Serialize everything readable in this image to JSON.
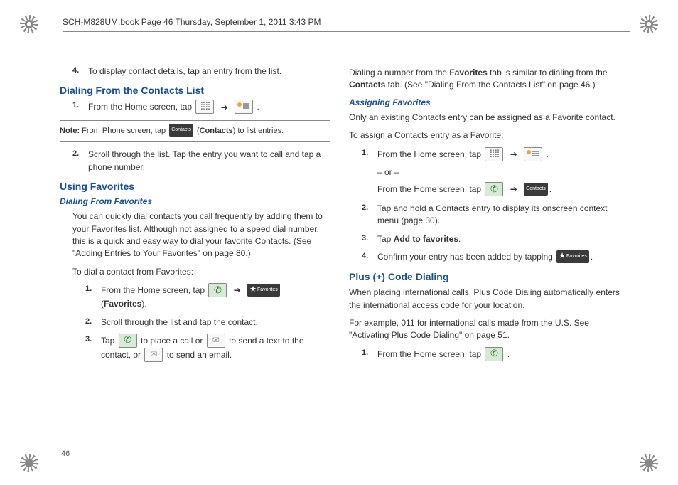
{
  "header": {
    "text": "SCH-M828UM.book  Page 46  Thursday, September 1, 2011  3:43 PM"
  },
  "left": {
    "step4": {
      "num": "4.",
      "text": "To display contact details, tap an entry from the list."
    },
    "section1_title": "Dialing From the Contacts List",
    "s1_step1": {
      "num": "1.",
      "prefix": "From the Home screen, tap ",
      "arrow": "➔",
      "suffix": " ."
    },
    "note": {
      "label": "Note:",
      "prefix": " From Phone screen, tap ",
      "contacts_label": "Contacts",
      "mid": "  (",
      "bold": "Contacts",
      "suffix": ") to list entries."
    },
    "s1_step2": {
      "num": "2.",
      "text": "Scroll through the list. Tap the entry you want to call and tap a phone number."
    },
    "section2_title": "Using Favorites",
    "sub1_title": "Dialing From Favorites",
    "fav_para": "You can quickly dial contacts you call frequently by adding them to your Favorites list. Although not assigned to a speed dial number, this is a quick and easy way to dial your favorite Contacts. (See \"Adding Entries to Your Favorites\" on page 80.)",
    "fav_intro": "To dial a contact from Favorites:",
    "fav_step1": {
      "num": "1.",
      "prefix": "From the Home screen, tap ",
      "arrow": "➔",
      "fav_label": "Favorites",
      "line2_open": "(",
      "line2_bold": "Favorites",
      "line2_close": ")."
    },
    "fav_step2": {
      "num": "2.",
      "text": "Scroll through the list and tap the contact."
    },
    "fav_step3": {
      "num": "3.",
      "p1": "Tap ",
      "p2": " to place a call or ",
      "p3": " to send a text to the contact, or ",
      "p4": " to send an email."
    }
  },
  "right": {
    "intro": {
      "p1": "Dialing a number from the ",
      "b1": "Favorites",
      "p2": " tab is similar to dialing from the ",
      "b2": "Contacts",
      "p3": " tab. (See \"Dialing From the Contacts List\" on page 46.)"
    },
    "sub2_title": "Assigning Favorites",
    "assign_p1": "Only an existing Contacts entry can be assigned as a Favorite contact.",
    "assign_p2": "To assign a Contacts entry as a Favorite:",
    "a_step1": {
      "num": "1.",
      "l1_prefix": "From the Home screen, tap ",
      "arrow": "➔",
      "l1_suffix": " .",
      "or": "– or –",
      "l2_prefix": "From the Home screen, tap ",
      "contacts_label": "Contacts",
      "l2_suffix": "."
    },
    "a_step2": {
      "num": "2.",
      "text": "Tap and hold a Contacts entry to display its onscreen context menu (page 30)."
    },
    "a_step3": {
      "num": "3.",
      "prefix": "Tap ",
      "bold": "Add to favorites",
      "suffix": "."
    },
    "a_step4": {
      "num": "4.",
      "prefix": "Confirm your entry has been added by tapping ",
      "fav_label": "Favorites",
      "suffix": "."
    },
    "section3_title": "Plus (+) Code Dialing",
    "plus_p1": "When placing international calls, Plus Code Dialing automatically enters the international access code for your location.",
    "plus_p2": "For example, 011 for international calls made from the U.S. See \"Activating Plus Code Dialing\" on page 51.",
    "plus_step1": {
      "num": "1.",
      "prefix": "From the Home screen, tap ",
      "suffix": " ."
    }
  },
  "page_number": "46"
}
